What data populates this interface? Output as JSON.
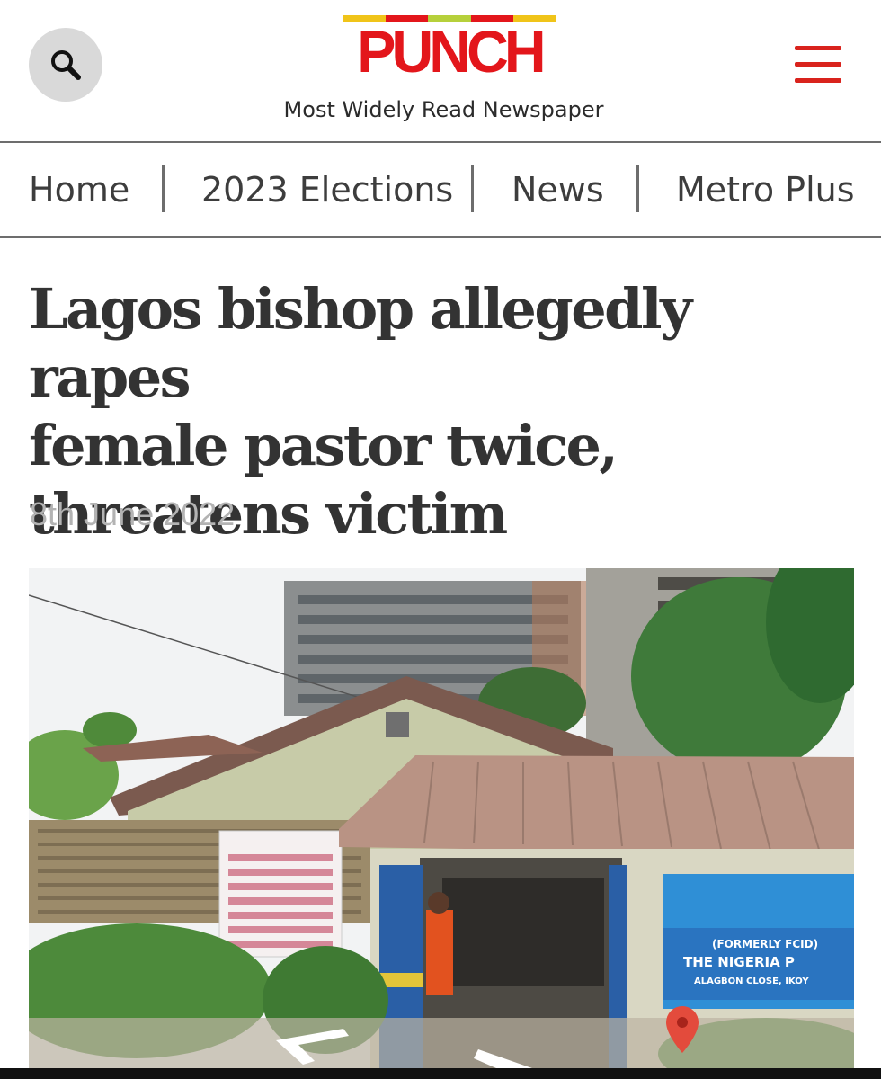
{
  "header": {
    "logo_text": "PUNCH",
    "tagline": "Most Widely Read Newspaper",
    "logo_colors": [
      "#f0c419",
      "#e3161b",
      "#b6d03b",
      "#e3161b",
      "#f0c419"
    ],
    "search_icon": "search-icon",
    "menu_icon": "hamburger-menu-icon"
  },
  "nav": {
    "items": [
      {
        "label": "Home"
      },
      {
        "label": "2023 Elections"
      },
      {
        "label": "News"
      },
      {
        "label": "Metro Plus"
      }
    ]
  },
  "article": {
    "headline_lines": [
      "Lagos bishop allegedly rapes",
      "female pastor twice,",
      "threatens victim"
    ],
    "date": "8th June 2022",
    "image": {
      "sign_lines": [
        "(FORMERLY FCID)",
        "THE NIGERIA P",
        "ALAGBON CLOSE, IKOY"
      ]
    }
  },
  "colors": {
    "brand_red": "#e3161b",
    "text_dark": "#333333",
    "date_gray": "#b3b3b3"
  }
}
